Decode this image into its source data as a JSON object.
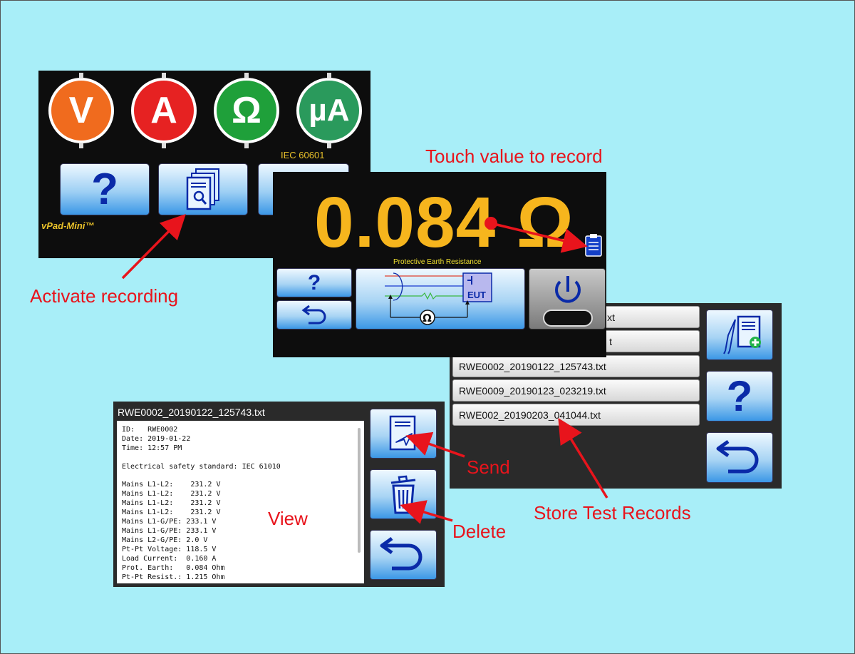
{
  "home": {
    "meters": [
      {
        "label": "V",
        "color": "#f06b1e",
        "name": "voltage-meter-button"
      },
      {
        "label": "A",
        "color": "#e62222",
        "name": "current-meter-button"
      },
      {
        "label": "Ω",
        "color": "#1fa03a",
        "name": "resistance-meter-button"
      },
      {
        "label": "µA",
        "color": "#2a9a5c",
        "name": "leakage-meter-button"
      }
    ],
    "standard": "IEC 60601",
    "help_label": "?",
    "brand": "vPad-Mini™"
  },
  "measure": {
    "value": "0.084 Ω",
    "test_name": "Protective Earth Resistance",
    "help_label": "?",
    "eut_label": "EUT",
    "ohm_symbol": "Ω"
  },
  "records": {
    "files": [
      "RWE0002_20190122_125743.txt",
      "RWE0009_20190123_023219.txt",
      "RWE002_20190203_041044.txt"
    ],
    "partial_file_suffixes": [
      "xt",
      "t"
    ],
    "help_label": "?"
  },
  "view": {
    "title": "RWE0002_20190122_125743.txt",
    "lines": [
      "ID:   RWE0002",
      "Date: 2019-01-22",
      "Time: 12:57 PM",
      "",
      "Electrical safety standard: IEC 61010",
      "",
      "Mains L1-L2:    231.2 V",
      "Mains L1-L2:    231.2 V",
      "Mains L1-L2:    231.2 V",
      "Mains L1-L2:    231.2 V",
      "Mains L1-G/PE: 233.1 V",
      "Mains L1-G/PE: 233.1 V",
      "Mains L2-G/PE: 2.0 V",
      "Pt-Pt Voltage: 118.5 V",
      "Load Current:  0.160 A",
      "Prot. Earth:   0.084 Ohm",
      "Pt-Pt Resist.: 1.215 Ohm"
    ]
  },
  "annotations": {
    "touch": "Touch value to record",
    "activate": "Activate recording",
    "send": "Send",
    "delete": "Delete",
    "view": "View",
    "store": "Store Test Records"
  },
  "colors": {
    "background": "#a8eef8",
    "annotation": "#e8141c",
    "value": "#f6b51d",
    "button_text": "#0a2aa8"
  }
}
